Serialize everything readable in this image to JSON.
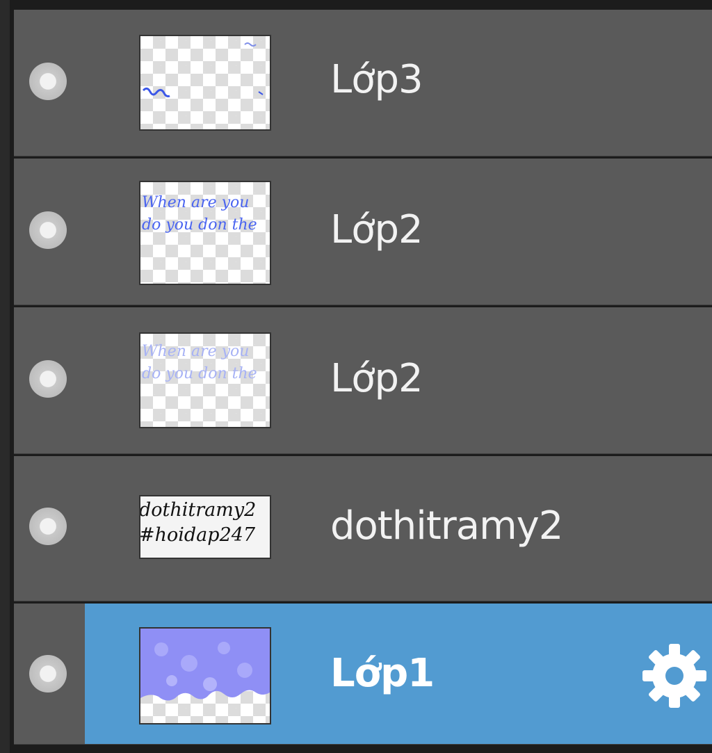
{
  "layers": [
    {
      "name": "Lớp3",
      "selected": false,
      "thumb": "scribble-blue"
    },
    {
      "name": "Lớp2",
      "selected": false,
      "thumb": "text-blue"
    },
    {
      "name": "Lớp2",
      "selected": false,
      "thumb": "text-blue-faded"
    },
    {
      "name": "dothitramy2",
      "selected": false,
      "thumb": "text-black"
    },
    {
      "name": "Lớp1",
      "selected": true,
      "thumb": "purple-fill"
    }
  ],
  "thumb_text": {
    "blue_line1": "When are you",
    "blue_line2": "do you don the",
    "black_line1": "dothitramy2",
    "black_line2": "#hoidap247"
  },
  "colors": {
    "row": "#5a5a5a",
    "selected": "#529bd1",
    "text": "#f2f2f2"
  },
  "icons": {
    "visibility": "visibility-toggle-icon",
    "settings": "gear-icon"
  }
}
